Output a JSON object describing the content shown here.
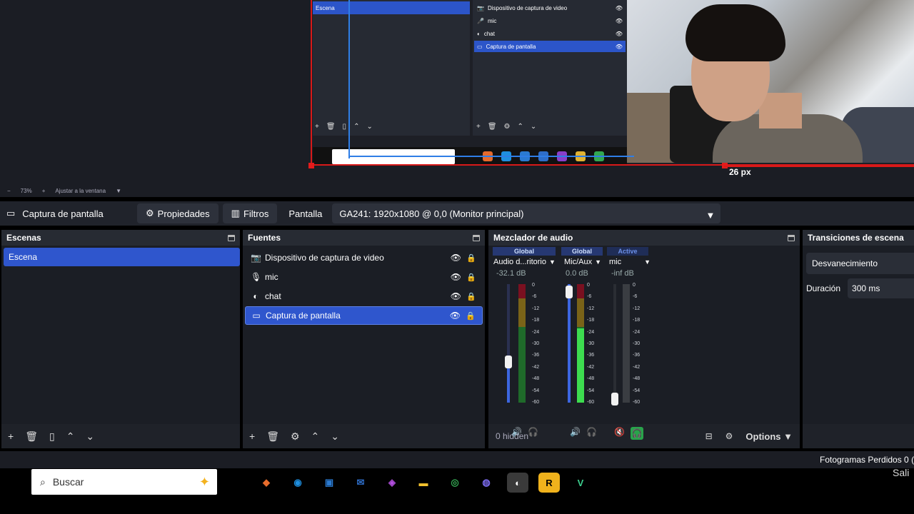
{
  "preview": {
    "mini_scene_label": "Escena",
    "mini_sources": [
      "Dispositivo de captura de video",
      "mic",
      "chat",
      "Captura de pantalla"
    ],
    "px_label": "26 px",
    "zoom_level": "73%",
    "fit_label": "Ajustar a la ventana"
  },
  "context": {
    "source_name": "Captura de pantalla",
    "properties_label": "Propiedades",
    "filters_label": "Filtros",
    "display_label": "Pantalla",
    "display_value": "GA241: 1920x1080 @ 0,0 (Monitor principal)"
  },
  "scenes": {
    "title": "Escenas",
    "items": [
      "Escena"
    ]
  },
  "sources": {
    "title": "Fuentes",
    "items": [
      {
        "label": "Dispositivo de captura de video",
        "icon": "camera-icon"
      },
      {
        "label": "mic",
        "icon": "microphone-icon"
      },
      {
        "label": "chat",
        "icon": "browser-icon"
      },
      {
        "label": "Captura de pantalla",
        "icon": "monitor-icon"
      }
    ]
  },
  "mixer": {
    "title": "Mezclador de audio",
    "channels": [
      {
        "tag": "Global",
        "name": "Audio d...ritorio",
        "db": "-32.1 dB"
      },
      {
        "tag": "Global",
        "name": "Mic/Aux",
        "db": "0.0 dB"
      },
      {
        "tag": "Active",
        "name": "mic",
        "db": "-inf dB"
      }
    ],
    "scale": [
      "0",
      "-6",
      "-12",
      "-18",
      "-24",
      "-30",
      "-36",
      "-42",
      "-48",
      "-54",
      "-60"
    ],
    "hidden_label": "0 hidden",
    "options_label": "Options"
  },
  "transitions": {
    "title": "Transiciones de escena",
    "type": "Desvanecimiento",
    "duration_label": "Duración",
    "duration_value": "300 ms"
  },
  "status": {
    "dropped_frames": "Fotogramas Perdidos 0 ("
  },
  "taskbar": {
    "search_placeholder": "Buscar",
    "salir": "Sali"
  },
  "colors": {
    "selection_blue": "#2f56cd",
    "guide_red": "#d81919",
    "meter_green": "#3ddc4f"
  }
}
